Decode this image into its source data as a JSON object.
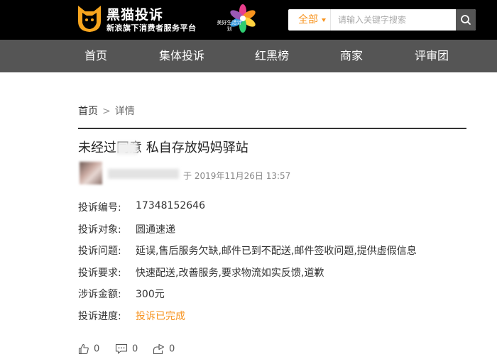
{
  "header": {
    "logo_icon": "black-cat-logo-icon",
    "logo_title": "黑猫投诉",
    "logo_subtitle": "新浪旗下消费者服务平台",
    "partner_badge": "美好生活计划",
    "search_category": "全部",
    "search_placeholder": "请输入关键字搜索",
    "search_icon": "search-icon"
  },
  "nav": {
    "items": [
      "首页",
      "集体投诉",
      "红黑榜",
      "商家",
      "评审团"
    ]
  },
  "breadcrumb": {
    "home": "首页",
    "separator": ">",
    "current": "详情"
  },
  "complaint": {
    "title": "未经过同意 私自存放妈妈驿站",
    "post_time": "于 2019年11月26日 13:57",
    "fields": [
      {
        "label": "投诉编号:",
        "value": "17348152646"
      },
      {
        "label": "投诉对象:",
        "value": "圆通速递"
      },
      {
        "label": "投诉问题:",
        "value": "延误,售后服务欠缺,邮件已到不配送,邮件签收问题,提供虚假信息"
      },
      {
        "label": "投诉要求:",
        "value": "快速配送,改善服务,要求物流如实反馈,道歉"
      },
      {
        "label": "涉诉金额:",
        "value": "300元"
      },
      {
        "label": "投诉进度:",
        "value": "投诉已完成"
      }
    ]
  },
  "actions": {
    "like_count": "0",
    "comment_count": "0",
    "share_count": "0"
  },
  "colors": {
    "accent": "#f7931e",
    "nav_bg": "#555555",
    "header_bg": "#000000"
  }
}
